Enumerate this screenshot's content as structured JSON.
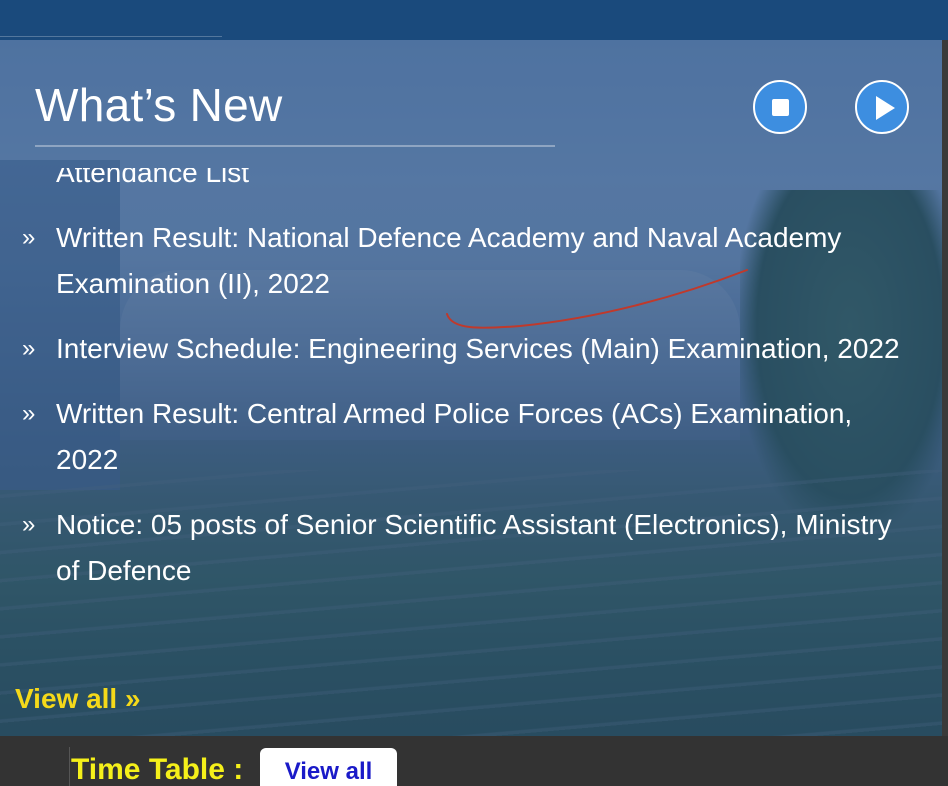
{
  "panel": {
    "title": "What’s New",
    "controls": {
      "stop_icon": "stop-icon",
      "play_icon": "play-icon"
    }
  },
  "news": {
    "bullet": "»",
    "items": [
      {
        "label": "Attendance List"
      },
      {
        "label": "Written Result: National Defence Academy and Naval Academy Examination (II), 2022"
      },
      {
        "label": "Interview Schedule: Engineering Services (Main) Examination, 2022"
      },
      {
        "label": "Written Result: Central Armed Police Forces (ACs) Examination, 2022"
      },
      {
        "label": "Notice: 05 posts of Senior Scientific Assistant (Electronics), Ministry of Defence"
      }
    ],
    "view_all": "View all »"
  },
  "time_table": {
    "label": "Time Table :",
    "button": "View all"
  },
  "colors": {
    "top_bar": "#1a4a7c",
    "overlay": "#1a4684",
    "control_button": "#3d8ee0",
    "view_all_link": "#f5d91a",
    "time_table_label": "#f5f01a",
    "time_table_button_text": "#1a1ac8",
    "annotation_stroke": "#c0392b"
  }
}
